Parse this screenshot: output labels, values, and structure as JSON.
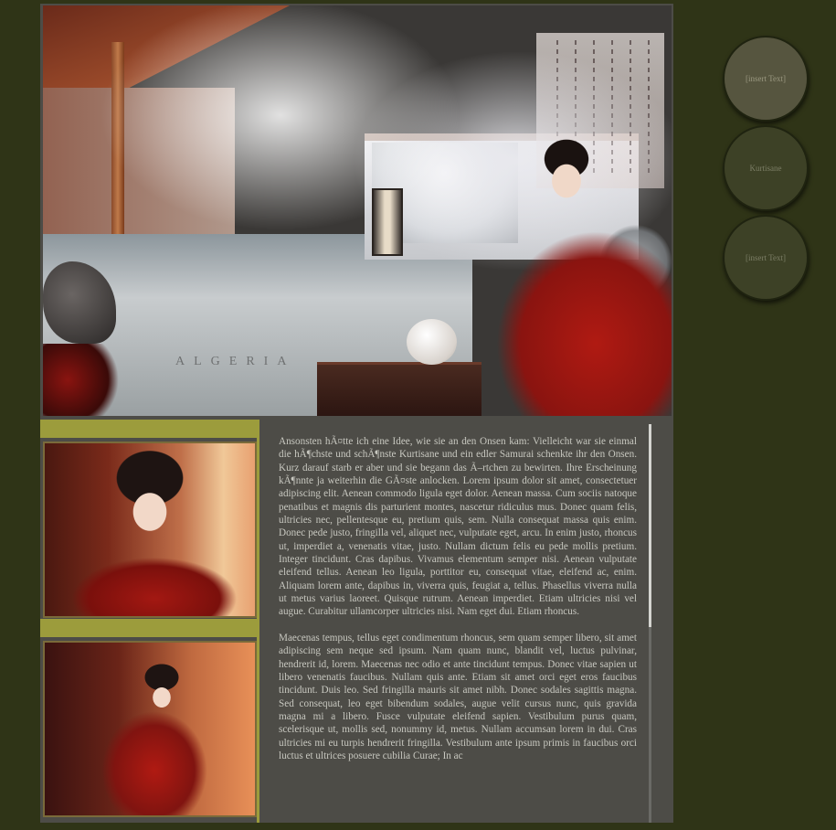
{
  "nav": {
    "items": [
      {
        "label": "[insert Text]",
        "active": true
      },
      {
        "label": "Kurtisane",
        "active": false
      },
      {
        "label": "[insert Text]",
        "active": false
      }
    ]
  },
  "banner": {
    "map_text": "ALGERIA"
  },
  "content": {
    "paragraphs": [
      "Ansonsten hÃ¤tte ich eine Idee, wie sie an den Onsen kam: Vielleicht war sie einmal die hÃ¶chste und schÃ¶nste Kurtisane und ein edler Samurai schenkte ihr den Onsen. Kurz darauf starb er aber und sie begann das Ã–rtchen zu bewirten. Ihre Erscheinung kÃ¶nnte ja weiterhin die GÃ¤ste anlocken. Lorem ipsum dolor sit amet, consectetuer adipiscing elit. Aenean commodo ligula eget dolor. Aenean massa. Cum sociis natoque penatibus et magnis dis parturient montes, nascetur ridiculus mus. Donec quam felis, ultricies nec, pellentesque eu, pretium quis, sem. Nulla consequat massa quis enim. Donec pede justo, fringilla vel, aliquet nec, vulputate eget, arcu. In enim justo, rhoncus ut, imperdiet a, venenatis vitae, justo. Nullam dictum felis eu pede mollis pretium. Integer tincidunt. Cras dapibus. Vivamus elementum semper nisi. Aenean vulputate eleifend tellus. Aenean leo ligula, porttitor eu, consequat vitae, eleifend ac, enim. Aliquam lorem ante, dapibus in, viverra quis, feugiat a, tellus. Phasellus viverra nulla ut metus varius laoreet. Quisque rutrum. Aenean imperdiet. Etiam ultricies nisi vel augue. Curabitur ullamcorper ultricies nisi. Nam eget dui. Etiam rhoncus.",
      "Maecenas tempus, tellus eget condimentum rhoncus, sem quam semper libero, sit amet adipiscing sem neque sed ipsum. Nam quam nunc, blandit vel, luctus pulvinar, hendrerit id, lorem. Maecenas nec odio et ante tincidunt tempus. Donec vitae sapien ut libero venenatis faucibus. Nullam quis ante. Etiam sit amet orci eget eros faucibus tincidunt. Duis leo. Sed fringilla mauris sit amet nibh. Donec sodales sagittis magna. Sed consequat, leo eget bibendum sodales, augue velit cursus nunc, quis gravida magna mi a libero. Fusce vulputate eleifend sapien. Vestibulum purus quam, scelerisque ut, mollis sed, nonummy id, metus. Nullam accumsan lorem in dui. Cras ultricies mi eu turpis hendrerit fringilla. Vestibulum ante ipsum primis in faucibus orci luctus et ultrices posuere cubilia Curae; In ac"
    ]
  },
  "colors": {
    "page_background": "#2f3417",
    "panel_background": "#4d4c47",
    "accent_olive": "#9c9c3c",
    "circle_button": "#3d4126",
    "circle_button_active": "#56553f",
    "text": "#c8c8c0"
  },
  "scroll": {
    "position_fraction": 0.0,
    "visible_fraction": 0.51
  }
}
